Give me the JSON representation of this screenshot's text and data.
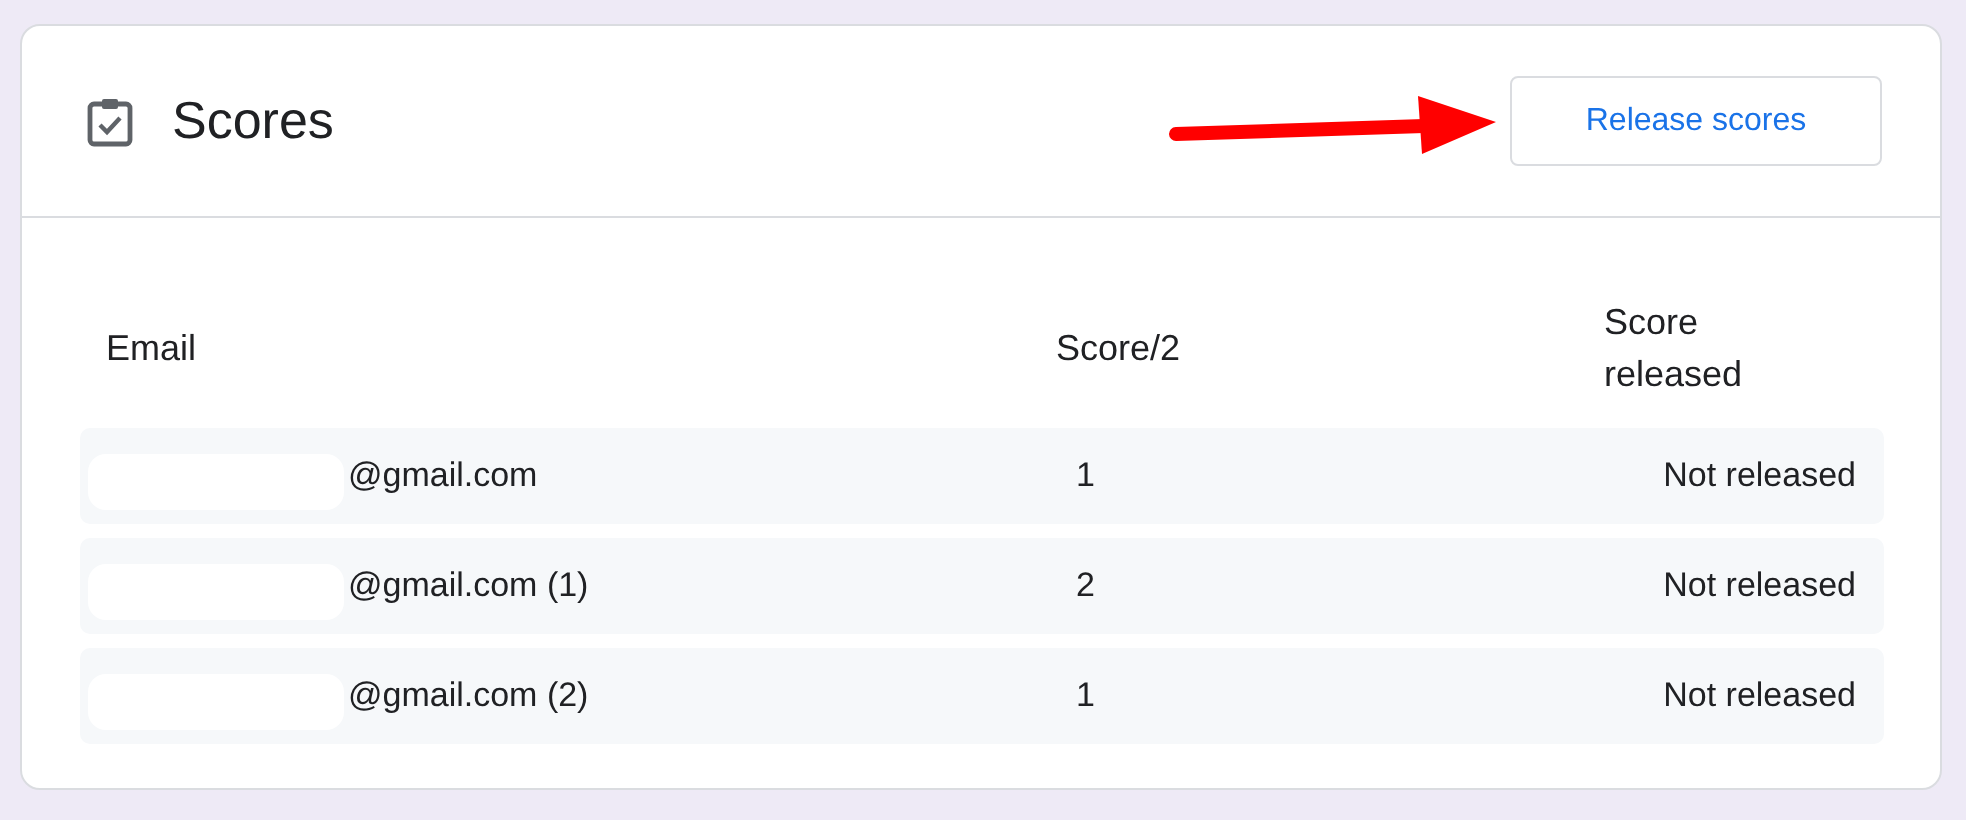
{
  "card": {
    "title": "Scores",
    "button": "Release scores"
  },
  "table": {
    "columns": [
      "Email",
      "Score/2",
      "Score released"
    ],
    "rows": [
      {
        "email": "@gmail.com",
        "score": "1",
        "released": "Not released"
      },
      {
        "email": "@gmail.com (1)",
        "score": "2",
        "released": "Not released"
      },
      {
        "email": "@gmail.com (2)",
        "score": "1",
        "released": "Not released"
      }
    ]
  }
}
